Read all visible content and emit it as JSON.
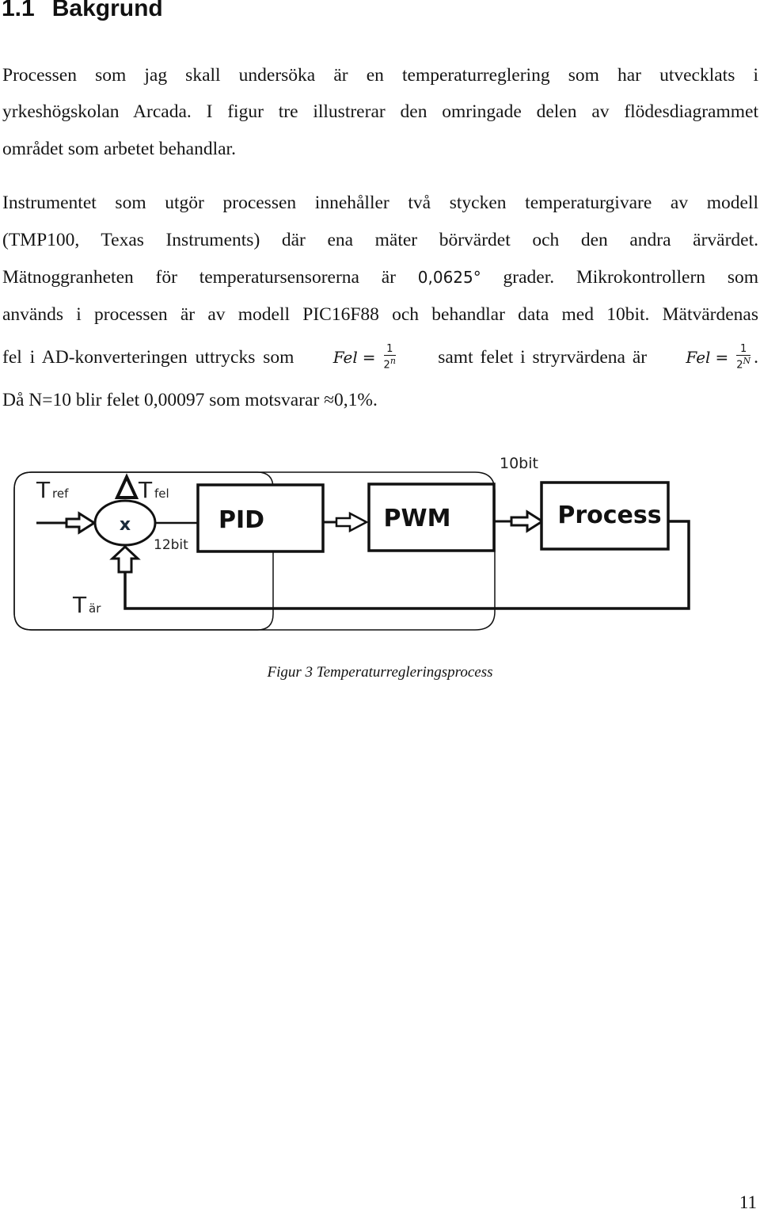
{
  "heading": {
    "number": "1.1",
    "title": "Bakgrund"
  },
  "paragraph1": [
    "Processen som jag skall undersöka är en temperaturreglering som har utvecklats i",
    "yrkeshögskolan Arcada. I figur tre illustrerar den omringade delen av flödesdiagrammet",
    "området som arbetet behandlar."
  ],
  "paragraph2": {
    "line1": "Instrumentet som utgör processen innehåller två stycken temperaturgivare av modell",
    "line2": "(TMP100, Texas Instruments) där ena mäter börvärdet och den andra ärvärdet.",
    "line3_a": "Mätnoggranheten för temperatursensorerna är ",
    "line3_value": "0,0625°",
    "line3_b": " grader. Mikrokontrollern som",
    "line4": "används i processen är av modell PIC16F88 och behandlar data med 10bit. Mätvärdenas",
    "line5_a": "fel i AD-konverteringen uttrycks som ",
    "formula1": {
      "lhs": "Fel",
      "eq": "=",
      "numerator": "1",
      "base": "2",
      "exponent": "n"
    },
    "line5_b": " samt felet i stryrvärdena är ",
    "formula2": {
      "lhs": "Fel",
      "eq": "=",
      "numerator": "1",
      "base": "2",
      "exponent": "N"
    },
    "line5_end": ".",
    "line6": "Då N=10 blir felet 0,00097 som motsvarar ≈0,1%."
  },
  "diagram": {
    "labels": {
      "t_ref_main": "T",
      "t_ref_sub": "ref",
      "delta": "Δ",
      "t_fel_main": "T",
      "t_fel_sub": "fel",
      "t_ar_main": "T",
      "t_ar_sub": "är",
      "junction": "x",
      "bits_12": "12bit",
      "bits_10": "10bit"
    },
    "blocks": [
      "PID",
      "PWM",
      "Process"
    ]
  },
  "caption": "Figur 3 Temperaturregleringsprocess",
  "page_number": "11"
}
